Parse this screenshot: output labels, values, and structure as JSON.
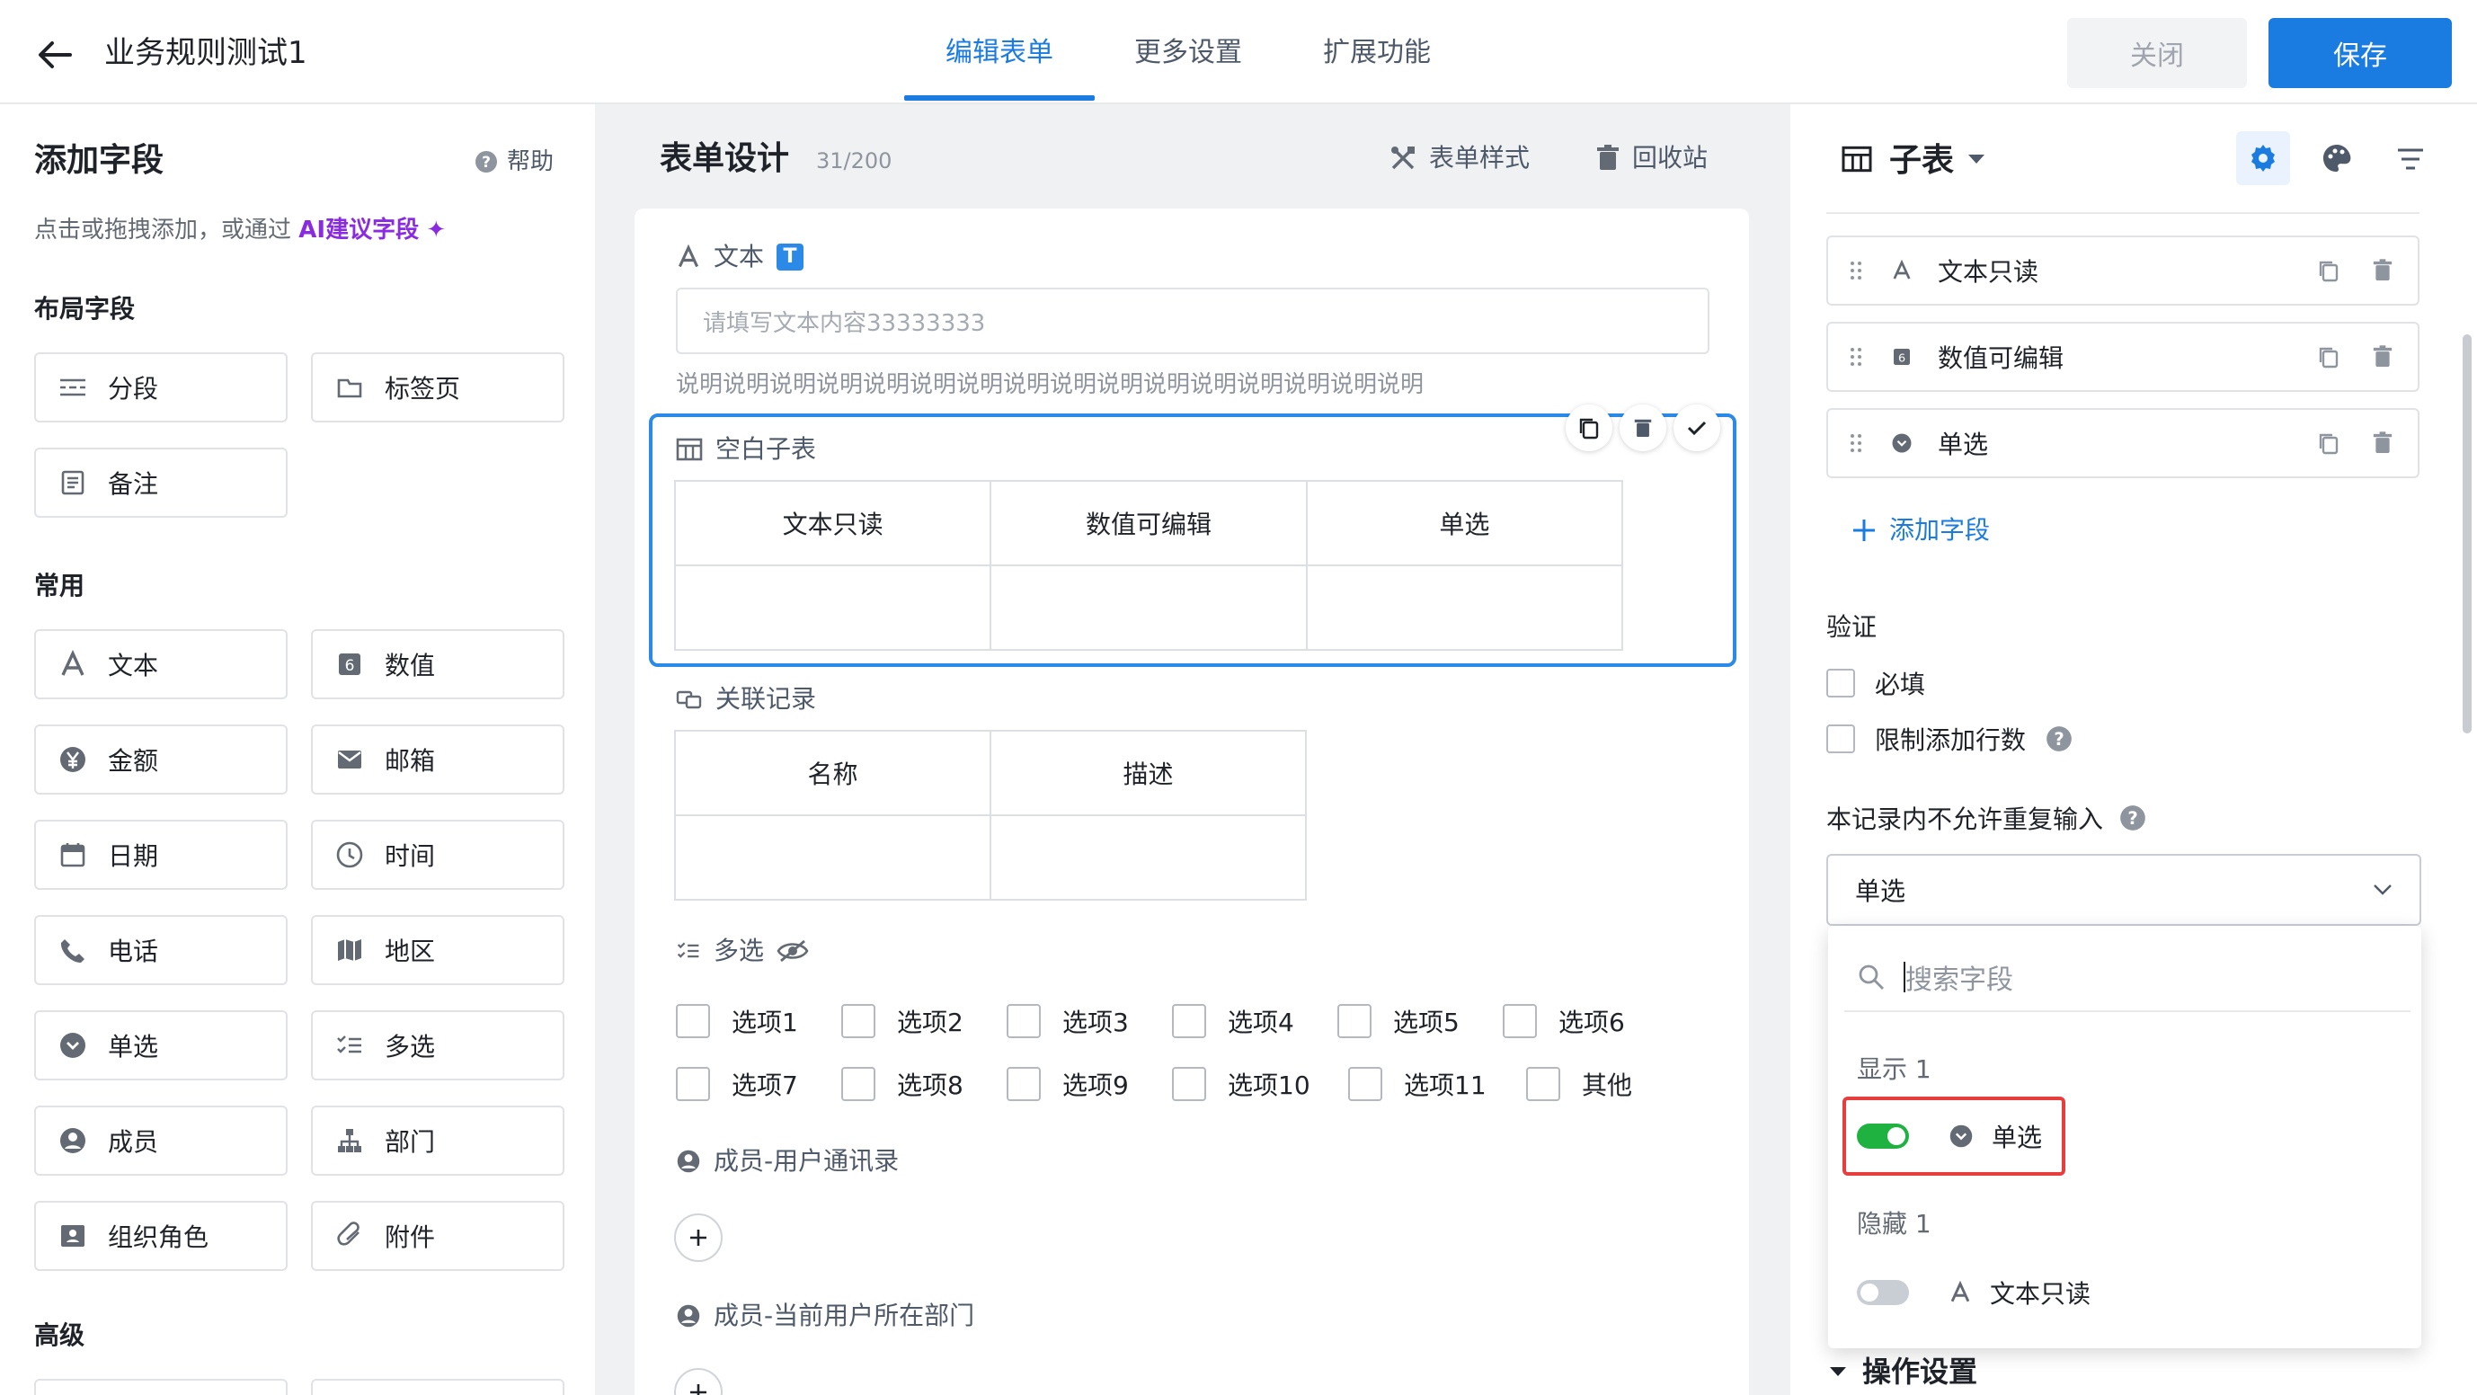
{
  "header": {
    "title": "业务规则测试1",
    "tabs": [
      {
        "label": "编辑表单",
        "active": true
      },
      {
        "label": "更多设置",
        "active": false
      },
      {
        "label": "扩展功能",
        "active": false
      }
    ],
    "close_label": "关闭",
    "save_label": "保存"
  },
  "left_panel": {
    "title": "添加字段",
    "help_label": "帮助",
    "hint_prefix": "点击或拖拽添加，或通过",
    "hint_ai": "AI建议字段",
    "groups": {
      "layout": "布局字段",
      "common": "常用",
      "advanced": "高级"
    },
    "layout_fields": [
      "分段",
      "标签页",
      "备注"
    ],
    "common_fields": [
      "文本",
      "数值",
      "金额",
      "邮箱",
      "日期",
      "时间",
      "电话",
      "地区",
      "单选",
      "多选",
      "成员",
      "部门",
      "组织角色",
      "附件"
    ]
  },
  "middle": {
    "title": "表单设计",
    "count": "31/200",
    "style_label": "表单样式",
    "recycle_label": "回收站",
    "text_field": {
      "label": "文本",
      "badge": "T",
      "placeholder": "请填写文本内容33333333",
      "description": "说明说明说明说明说明说明说明说明说明说明说明说明说明说明说明说明"
    },
    "subtable": {
      "label": "空白子表",
      "columns": [
        "文本只读",
        "数值可编辑",
        "单选"
      ]
    },
    "linked": {
      "label": "关联记录",
      "columns": [
        "名称",
        "描述"
      ]
    },
    "multi": {
      "label": "多选",
      "row1": [
        "选项1",
        "选项2",
        "选项3",
        "选项4",
        "选项5",
        "选项6"
      ],
      "row2": [
        "选项7",
        "选项8",
        "选项9",
        "选项10",
        "选项11",
        "其他"
      ]
    },
    "member1_label": "成员-用户通讯录",
    "member2_label": "成员-当前用户所在部门"
  },
  "right_panel": {
    "title": "子表",
    "sub_fields": [
      "文本只读",
      "数值可编辑",
      "单选"
    ],
    "add_field_label": "添加字段",
    "validation_label": "验证",
    "required_label": "必填",
    "limit_rows_label": "限制添加行数",
    "no_dup_label": "本记录内不允许重复输入",
    "selected_value": "单选",
    "search_placeholder": "搜索字段",
    "shown_group": "显示 1",
    "shown_item": "单选",
    "hidden_group": "隐藏 1",
    "hidden_item": "文本只读",
    "ops_label": "操作设置"
  },
  "colors": {
    "accent": "#1a7be0",
    "ai": "#8a2be2",
    "toggle_on": "#1fb241",
    "highlight": "#e83d3d"
  }
}
